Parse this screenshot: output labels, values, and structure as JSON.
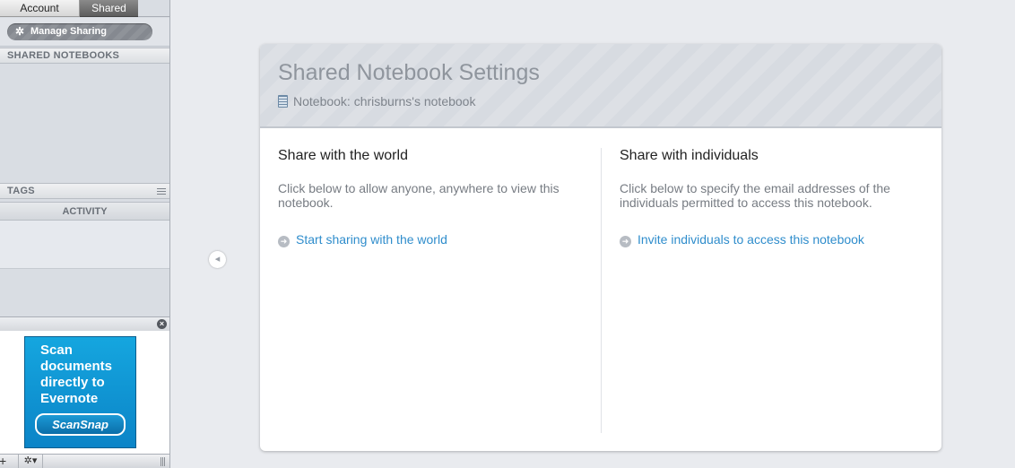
{
  "sidebar": {
    "tabs": [
      {
        "label": "Account"
      },
      {
        "label": "Shared"
      }
    ],
    "manage_button": "Manage Sharing",
    "sections": {
      "shared_notebooks": "SHARED NOTEBOOKS",
      "tags": "TAGS",
      "activity": "ACTIVITY"
    },
    "ad": {
      "text": "Scan documents directly to Evernote",
      "logo": "ScanSnap"
    }
  },
  "main": {
    "title": "Shared Notebook Settings",
    "notebook_line": "Notebook: chrisburns's notebook",
    "world": {
      "title": "Share with the world",
      "description": "Click below to allow anyone, anywhere to view this notebook.",
      "link": "Start sharing with the world"
    },
    "individuals": {
      "title": "Share with individuals",
      "description": "Click below to specify the email addresses of the individuals permitted to access this notebook.",
      "link": "Invite individuals to access this notebook"
    }
  },
  "icons": {
    "gear": "gear-icon",
    "notebook": "notebook-icon",
    "arrow": "arrow-right-icon",
    "close": "close-icon",
    "collapse": "collapse-left-icon"
  }
}
